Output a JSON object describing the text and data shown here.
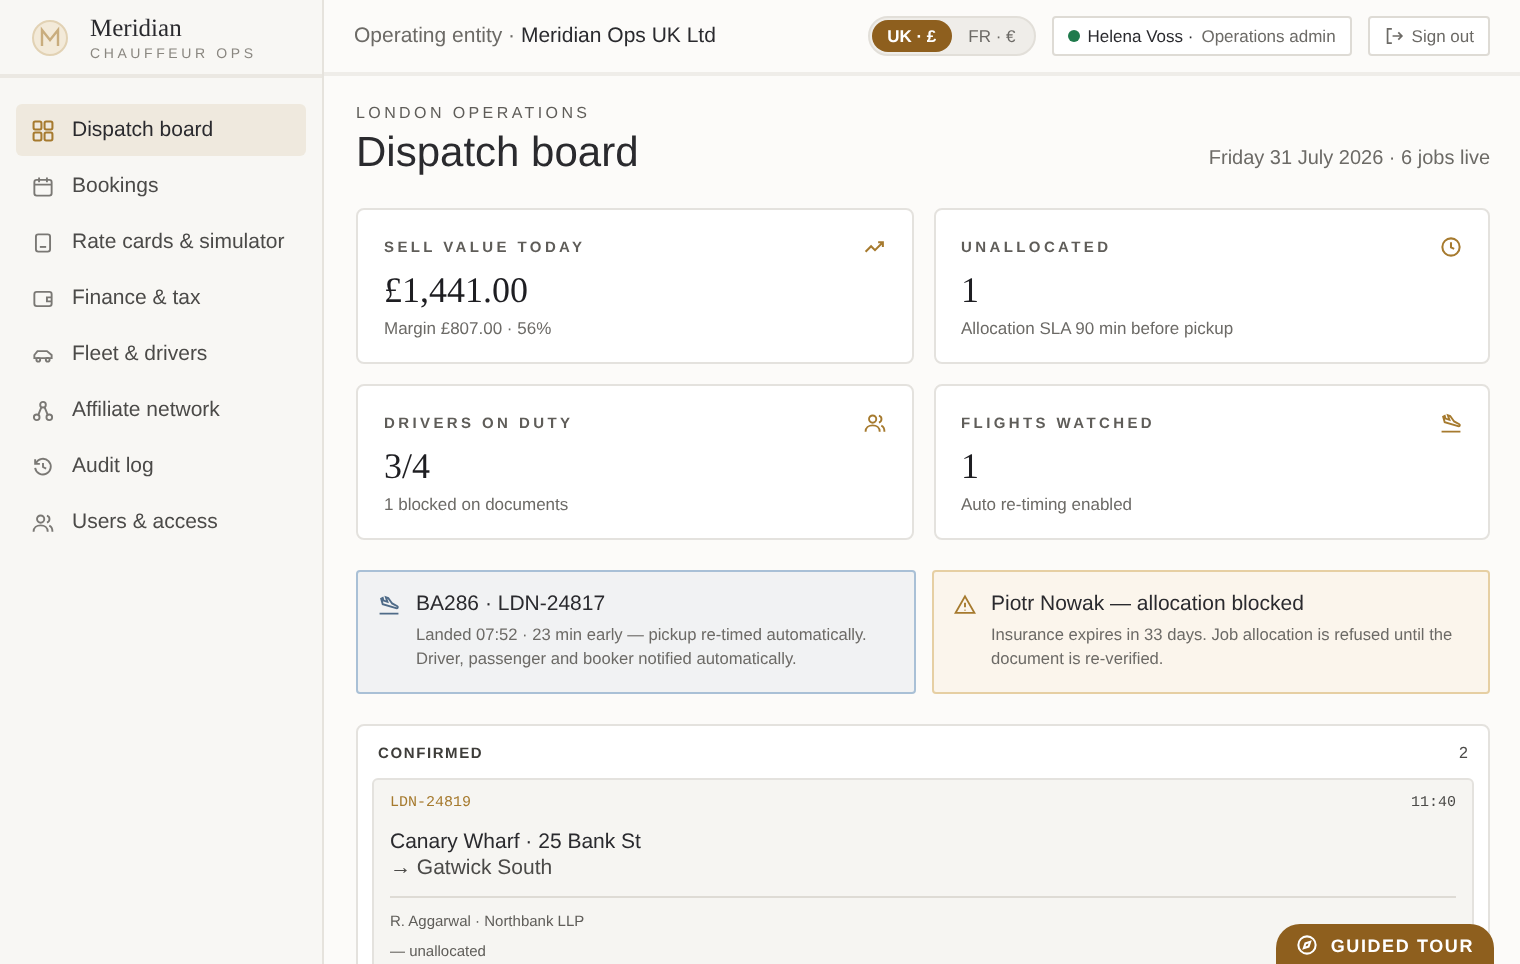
{
  "brand": {
    "name": "Meridian",
    "subtitle": "CHAUFFEUR OPS"
  },
  "sidebar": {
    "items": [
      {
        "label": "Dispatch board",
        "kind": "grid",
        "selected": true
      },
      {
        "label": "Bookings",
        "kind": "calendar",
        "selected": false
      },
      {
        "label": "Rate cards & simulator",
        "kind": "doc",
        "selected": false
      },
      {
        "label": "Finance & tax",
        "kind": "wallet",
        "selected": false
      },
      {
        "label": "Fleet & drivers",
        "kind": "car",
        "selected": false
      },
      {
        "label": "Affiliate network",
        "kind": "network",
        "selected": false
      },
      {
        "label": "Audit log",
        "kind": "history",
        "selected": false
      },
      {
        "label": "Users & access",
        "kind": "users",
        "selected": false
      }
    ]
  },
  "header": {
    "entity_label": "Operating entity ·",
    "entity": "Meridian Ops UK Ltd",
    "regions": [
      {
        "label": "UK · £",
        "selected": true
      },
      {
        "label": "FR · €",
        "selected": false
      }
    ],
    "user": {
      "name": "Helena Voss ·",
      "role": "Operations admin",
      "online": true
    },
    "sign_out": "Sign out"
  },
  "page": {
    "eyebrow": "LONDON OPERATIONS",
    "title": "Dispatch board",
    "summary": "Friday 31 July 2026 · 6 jobs live"
  },
  "stats": [
    {
      "label": "SELL VALUE TODAY",
      "value": "£1,441.00",
      "note": "Margin £807.00 · 56%",
      "kind": "trend"
    },
    {
      "label": "UNALLOCATED",
      "value": "1",
      "note": "Allocation SLA 90 min before pickup",
      "kind": "clock"
    },
    {
      "label": "DRIVERS ON DUTY",
      "value": "3/4",
      "note": "1 blocked on documents",
      "kind": "users"
    },
    {
      "label": "FLIGHTS WATCHED",
      "value": "1",
      "note": "Auto re-timing enabled",
      "kind": "landing"
    }
  ],
  "alerts": [
    {
      "kind": "info",
      "title": "BA286 · LDN-24817",
      "text": "Landed 07:52 · 23 min early — pickup re-timed automatically. Driver, passenger and booker notified automatically."
    },
    {
      "kind": "warning",
      "title": "Piotr Nowak — allocation blocked",
      "text": "Insurance expires in 33 days. Job allocation is refused until the document is re-verified."
    }
  ],
  "column": {
    "title": "CONFIRMED",
    "count": "2",
    "jobs": [
      {
        "ref": "LDN-24819",
        "time": "11:40",
        "from": "Canary Wharf · 25 Bank St",
        "to": "→ Gatwick South",
        "booker": "R. Aggarwal · Northbank LLP",
        "driver": "— unallocated"
      }
    ]
  },
  "tour_button": "GUIDED TOUR"
}
